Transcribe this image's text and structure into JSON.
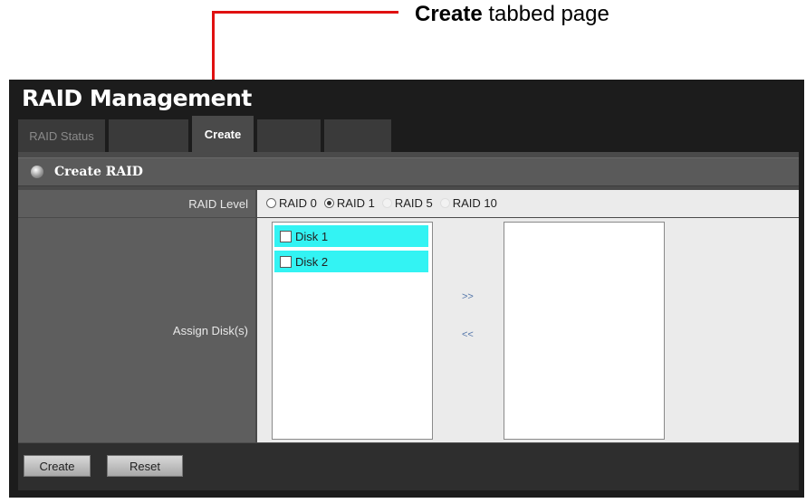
{
  "annotation": {
    "bold": "Create",
    "rest": " tabbed page",
    "color": "#e01010"
  },
  "app": {
    "title": "RAID Management"
  },
  "tabs": [
    {
      "label": "RAID Status",
      "state": "inactive"
    },
    {
      "label": "",
      "state": "ghost"
    },
    {
      "label": "Create",
      "state": "active"
    },
    {
      "label": "",
      "state": "ghost"
    },
    {
      "label": "",
      "state": "ghost"
    }
  ],
  "section": {
    "title": "Create RAID"
  },
  "form": {
    "raid_level_label": "RAID Level",
    "raid_options": [
      {
        "label": "RAID 0",
        "checked": false
      },
      {
        "label": "RAID 1",
        "checked": true
      },
      {
        "label": "RAID 5",
        "checked": false
      },
      {
        "label": "RAID 10",
        "checked": false
      }
    ],
    "assign_label": "Assign Disk(s)",
    "available_disks": [
      "Disk 1",
      "Disk 2"
    ],
    "move_right": ">>",
    "move_left": "<<"
  },
  "buttons": {
    "create": "Create",
    "reset": "Reset"
  },
  "colors": {
    "disk_highlight": "#33f3f3",
    "frame": "#1c1c1c"
  }
}
